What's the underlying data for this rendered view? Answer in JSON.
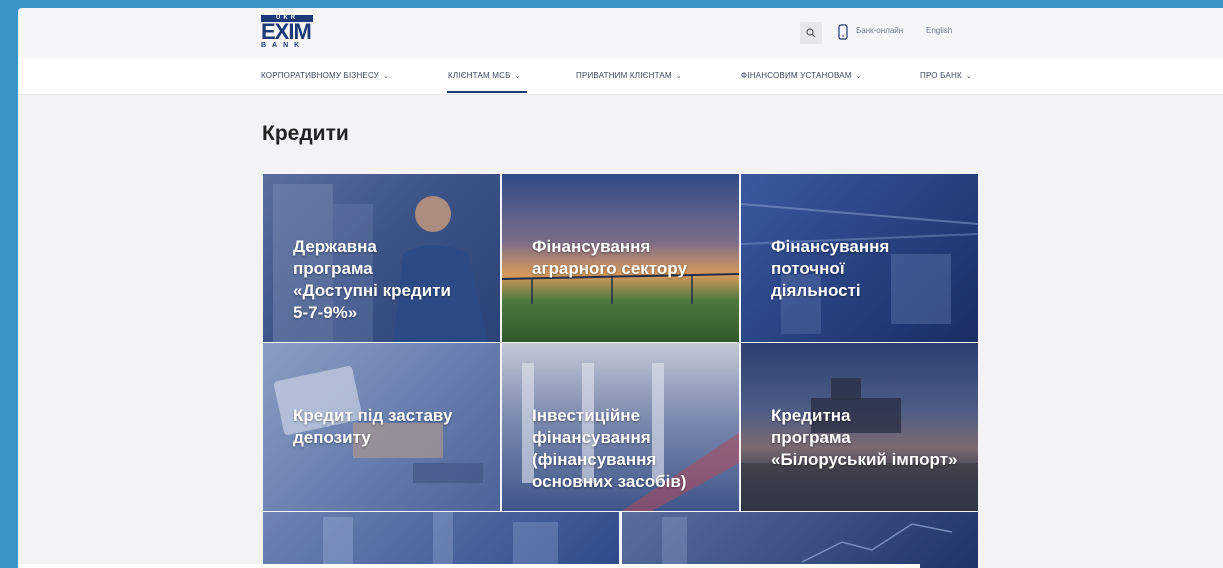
{
  "header": {
    "logo": {
      "top": "UKR",
      "main": "EXIM",
      "bottom": "BANK"
    },
    "internet_bank": "Банк-онлайн",
    "language": "English"
  },
  "nav": {
    "items": [
      {
        "label": "КОРПОРАТИВНОМУ БІЗНЕСУ"
      },
      {
        "label": "КЛІЄНТАМ МСБ"
      },
      {
        "label": "ПРИВАТНИМ КЛІЄНТАМ"
      },
      {
        "label": "ФІНАНСОВИМ УСТАНОВАМ"
      },
      {
        "label": "ПРО БАНК"
      }
    ],
    "active_index": 1
  },
  "page": {
    "title": "Кредити"
  },
  "tiles": [
    {
      "label": "Державна\nпрограма\n«Доступні кредити\n5-7-9%»"
    },
    {
      "label": "Фінансування\nаграрного сектору"
    },
    {
      "label": "Фінансування\nпоточної\nдіяльності"
    },
    {
      "label": "Кредит під заставу\nдепозиту"
    },
    {
      "label": "Інвестиційне\nфінансування\n(фінансування\nосновних засобів)"
    },
    {
      "label": "Кредитна\nпрограма\n«Білоруський імпорт»"
    }
  ],
  "colors": {
    "brand": "#1d3a78",
    "outer_background": "#3b95c7"
  }
}
